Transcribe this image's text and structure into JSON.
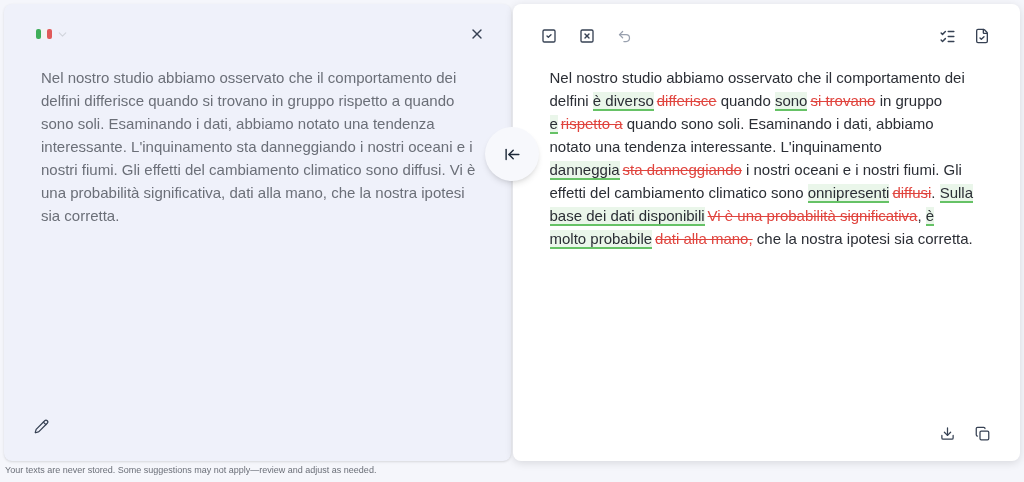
{
  "source_panel": {
    "language_menu": {
      "expanded": false
    },
    "text": "Nel nostro studio abbiamo osservato che il comportamento dei delfini differisce quando si trovano in gruppo rispetto a quando sono soli. Esaminando i dati, abbiamo notato una tendenza interessante. L'inquinamento sta danneggiando i nostri oceani e i nostri fiumi. Gli effetti del cambiamento climatico sono diffusi. Vi è una probabilità significativa, dati alla mano, che la nostra ipotesi sia corretta."
  },
  "result_panel": {
    "toolbar": [
      {
        "kind": "accept_all",
        "disabled": false
      },
      {
        "kind": "reject_all",
        "disabled": false
      },
      {
        "kind": "undo",
        "disabled": true
      }
    ],
    "segments": [
      {
        "kind": "plain",
        "text": "Nel nostro studio abbiamo osservato che il comportamento dei delfini "
      },
      {
        "kind": "insert",
        "text": "è diverso"
      },
      {
        "kind": "delete",
        "text": "differisce"
      },
      {
        "kind": "plain",
        "text": " quando "
      },
      {
        "kind": "insert",
        "text": "sono"
      },
      {
        "kind": "delete",
        "text": "si trovano"
      },
      {
        "kind": "plain",
        "text": " in gruppo "
      },
      {
        "kind": "insert",
        "text": "e"
      },
      {
        "kind": "delete",
        "text": "rispetto a"
      },
      {
        "kind": "plain",
        "text": " quando sono soli. Esaminando i dati, abbiamo notato una tendenza interessante. L'inquinamento "
      },
      {
        "kind": "insert",
        "text": "danneggia"
      },
      {
        "kind": "delete",
        "text": "sta danneggiando"
      },
      {
        "kind": "plain",
        "text": " i nostri oceani e i nostri fiumi. Gli effetti del cambiamento climatico sono "
      },
      {
        "kind": "insert",
        "text": "onnipresenti"
      },
      {
        "kind": "delete",
        "text": "diffusi"
      },
      {
        "kind": "plain",
        "text": ". "
      },
      {
        "kind": "insert",
        "text": "Sulla base dei dati disponibili"
      },
      {
        "kind": "delete",
        "text": "Vi è una probabilità significativa"
      },
      {
        "kind": "plain",
        "text": ", "
      },
      {
        "kind": "insert",
        "text": "è molto probabile"
      },
      {
        "kind": "delete",
        "text": "dati alla mano,"
      },
      {
        "kind": "plain",
        "text": " che la nostra ipotesi sia corretta."
      }
    ]
  },
  "footer": "Your texts are never stored. Some suggestions may not apply—review and adjust as needed."
}
